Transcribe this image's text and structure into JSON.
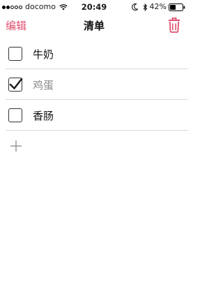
{
  "status_bar": {
    "carrier": "docomo",
    "time": "20:49",
    "battery_percent": "42%",
    "signal_bars_filled": 2,
    "signal_bars_total": 5
  },
  "nav": {
    "edit_label": "编辑",
    "title": "清单",
    "trash_icon": "trash-icon"
  },
  "items": [
    {
      "label": "牛奶",
      "checked": false
    },
    {
      "label": "鸡蛋",
      "checked": true
    },
    {
      "label": "香肠",
      "checked": false
    }
  ],
  "colors": {
    "accent": "#e0506e",
    "checked_text": "#8a8a8a",
    "divider": "#d9d9d9"
  }
}
